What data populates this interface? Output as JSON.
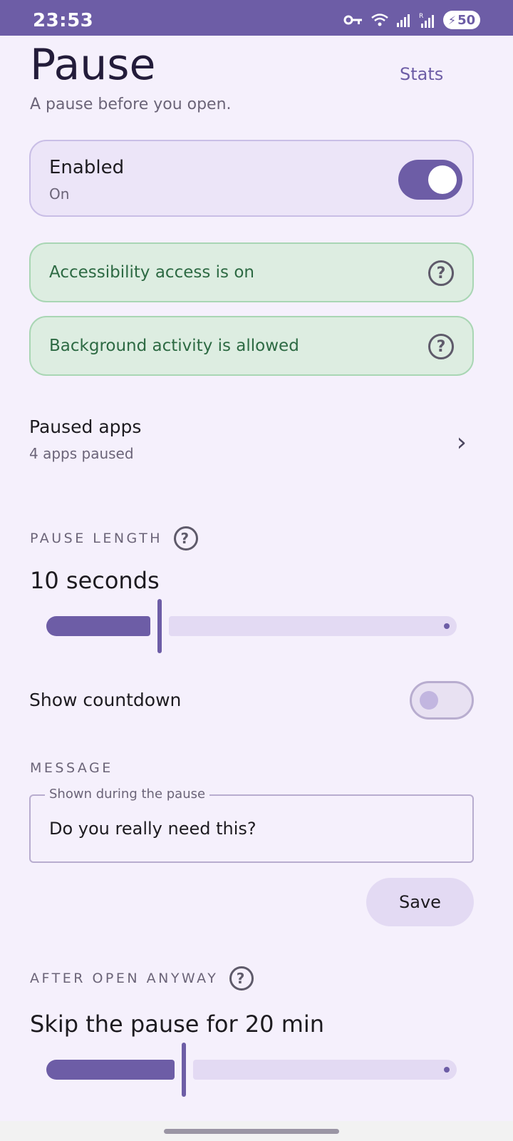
{
  "status_bar": {
    "time": "23:53",
    "battery": "50",
    "icons": [
      "vpn-key-icon",
      "wifi-icon",
      "signal-icon",
      "signal-roaming-icon",
      "battery-charging-icon"
    ]
  },
  "header": {
    "title": "Pause",
    "stats_link": "Stats",
    "subtitle": "A pause before you open."
  },
  "enabled_card": {
    "label": "Enabled",
    "state": "On",
    "toggle_on": true
  },
  "status_cards": [
    {
      "label": "Accessibility access is on",
      "icon": "help-icon"
    },
    {
      "label": "Background activity is allowed",
      "icon": "help-icon"
    }
  ],
  "paused_apps": {
    "label": "Paused apps",
    "sub": "4 apps paused",
    "icon": "chevron-right-icon"
  },
  "pause_length": {
    "section_label": "PAUSE LENGTH",
    "value_text": "10 seconds",
    "slider_fraction": 0.27
  },
  "show_countdown": {
    "label": "Show countdown",
    "toggle_on": false
  },
  "message": {
    "section_label": "MESSAGE",
    "field_label": "Shown during the pause",
    "field_value": "Do you really need this?",
    "save_label": "Save"
  },
  "after_open": {
    "section_label": "AFTER OPEN ANYWAY",
    "value_text": "Skip the pause for 20 min",
    "slider_fraction": 0.33
  },
  "colors": {
    "accent": "#6D5DA6",
    "background": "#F5F0FC",
    "success_bg": "#DDEDE1",
    "success_text": "#2D6A43"
  }
}
